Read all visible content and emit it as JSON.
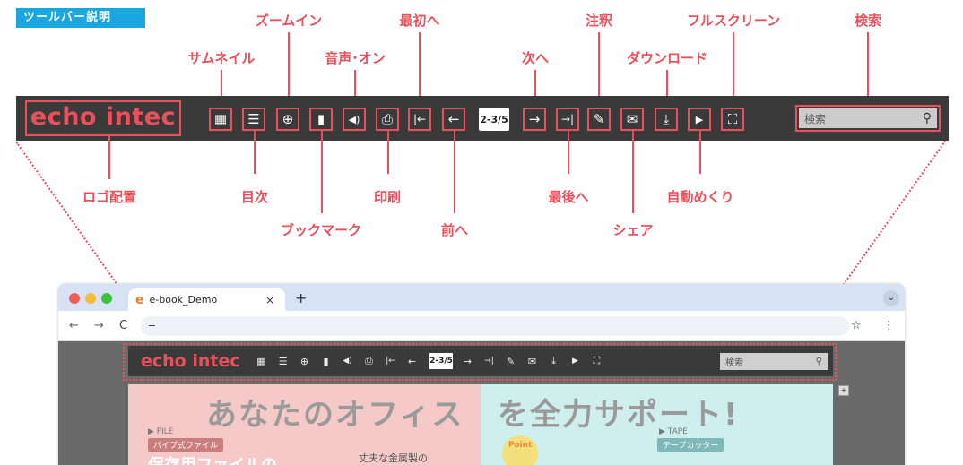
{
  "title_tag": "ツールバー説明",
  "labels_top": {
    "thumbnail": "サムネイル",
    "zoom_in": "ズームイン",
    "sound_on": "音声･オン",
    "first": "最初へ",
    "next": "次へ",
    "annotation": "注釈",
    "download": "ダウンロード",
    "fullscreen": "フルスクリーン",
    "search": "検索"
  },
  "labels_bottom": {
    "logo_placement": "ロゴ配置",
    "toc": "目次",
    "bookmark": "ブックマーク",
    "print": "印刷",
    "prev": "前へ",
    "last": "最後へ",
    "share": "シェア",
    "autoflip": "自動めくり"
  },
  "toolbar": {
    "logo": "echo intec",
    "page_indicator": "2-3/5",
    "search_placeholder": "検索",
    "icons": {
      "thumbnail": "▦",
      "toc": "☰",
      "zoom": "⊕",
      "bookmark": "▮",
      "sound": "◀)",
      "print": "⎙",
      "first": "|←",
      "prev": "←",
      "next": "→",
      "last": "→|",
      "annotate": "✎",
      "share": "✉",
      "download": "⤓",
      "autoflip": "▶",
      "fullscreen": "⛶",
      "search": "⚲"
    }
  },
  "browser": {
    "tab_title": "e-book_Demo",
    "tab_close": "×",
    "new_tab": "+",
    "menu_chevron": "⌄",
    "back": "←",
    "forward": "→",
    "reload": "C",
    "site_icon": "⚌",
    "star": "☆",
    "more": "⋮",
    "mini_logo": "echo intec",
    "mini_page": "2-3/5",
    "mini_search": "検索",
    "heading_left": "あなたのオフィス",
    "heading_right": "を全力サポート!",
    "left_pill": "パイプ式ファイル",
    "left_small": "▶ FILE",
    "left_big": "保存用ファイルの",
    "left_copy": "丈夫な金属製の",
    "right_small": "▶ TAPE",
    "right_pill": "テープカッター",
    "right_point": "Point"
  },
  "colors": {
    "accent": "#e8505b",
    "tag_bg": "#1aa7e0",
    "toolbar_bg": "#3a3a3a"
  }
}
